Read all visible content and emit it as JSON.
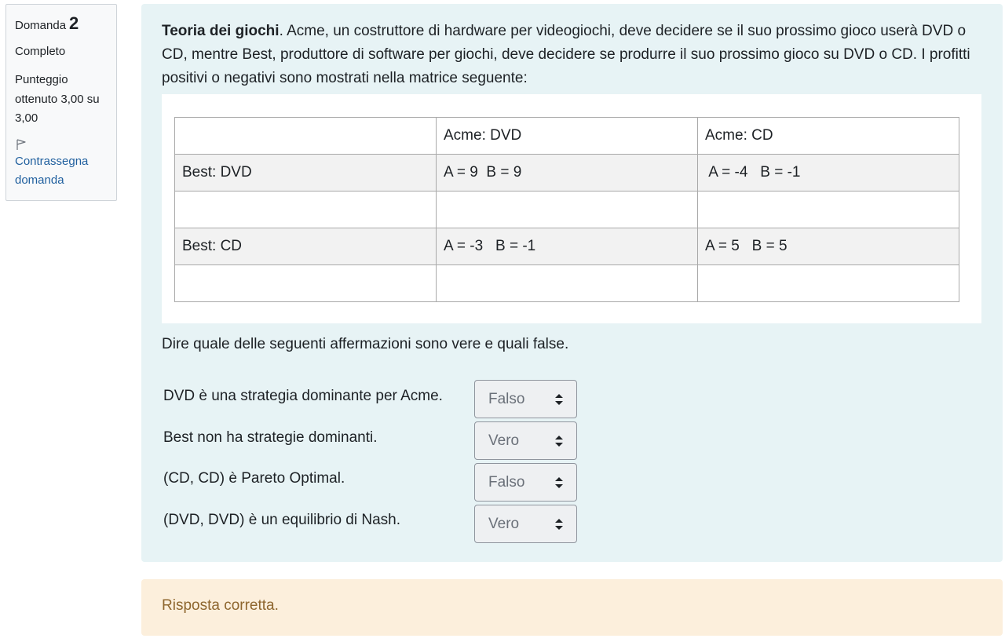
{
  "info": {
    "question_label": "Domanda",
    "question_number": "2",
    "state": "Completo",
    "grade": "Punteggio ottenuto 3,00 su 3,00",
    "flag_label": "Contrassegna domanda"
  },
  "question": {
    "title": "Teoria dei giochi",
    "text": ". Acme, un costruttore di hardware per videogiochi, deve decidere se il suo prossimo gioco userà DVD o CD, mentre Best, produttore di software per giochi, deve decidere se produrre il suo prossimo gioco su DVD o CD. I  profitti positivi o negativi sono mostrati nella matrice seguente:",
    "matrix": [
      [
        "",
        "Acme: DVD",
        "Acme: CD"
      ],
      [
        "Best: DVD",
        "A = 9  B = 9",
        " A = -4   B = -1"
      ],
      [
        "",
        "",
        ""
      ],
      [
        "Best: CD",
        "A = -3   B = -1",
        "A = 5   B = 5"
      ],
      [
        "",
        "",
        ""
      ]
    ],
    "prompt": "Dire quale delle seguenti affermazioni sono vere e quali false."
  },
  "statements": [
    {
      "text": "DVD è una strategia dominante per Acme.",
      "answer": "Falso"
    },
    {
      "text": "Best non ha strategie dominanti.",
      "answer": "Vero"
    },
    {
      "text": "(CD, CD) è Pareto Optimal.",
      "answer": "Falso"
    },
    {
      "text": "(DVD, DVD) è un equilibrio di Nash.",
      "answer": "Vero"
    }
  ],
  "feedback": "Risposta corretta."
}
